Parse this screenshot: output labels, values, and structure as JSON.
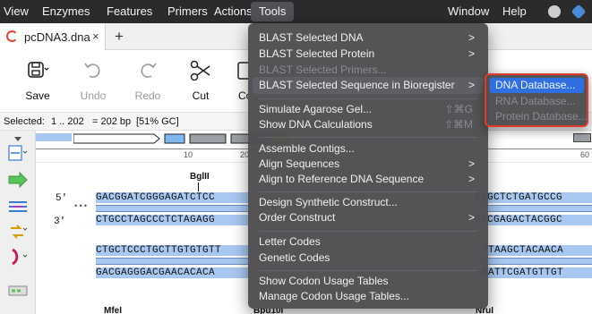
{
  "menubar": {
    "items": [
      "View",
      "Enzymes",
      "Features",
      "Primers",
      "Actions",
      "Tools"
    ],
    "right_items": [
      "Window",
      "Help"
    ]
  },
  "tabs": {
    "active_tab": "pcDNA3.dna",
    "close": "×",
    "new_tab": "+"
  },
  "toolbar": {
    "save": "Save",
    "undo": "Undo",
    "redo": "Redo",
    "cut": "Cut",
    "partial": "Co"
  },
  "status": {
    "selected": "Selected:",
    "range": "1 .. 202",
    "length": "=  202 bp",
    "gc": "[51% GC]"
  },
  "ruler": [
    "10",
    "20",
    "60"
  ],
  "sequence": {
    "enzyme_top": "BglII",
    "five_prime": "5'",
    "three_prime": "3'",
    "ellipsis": "•••",
    "row1_top_left": "GACGGATCGGGAGATCTCC",
    "row1_bottom_left": "CTGCCTAGCCCTCTAGAGG",
    "row1_top_right": "CTGCTCTGATGCCG",
    "row1_bottom_right": "GACGAGACTACGGC",
    "row2_top_left": "CTGCTCCCTGCTTGTGTGTT",
    "row2_bottom_left": "GACGAGGGACGAACACACA",
    "row2_top_right": "TTAAGCTACAACA",
    "row2_bottom_right": "AATTCGATGTTGT",
    "enzymes_bottom": [
      "MfeI",
      "Bpu10I",
      "NruI"
    ]
  },
  "tools_menu": [
    {
      "label": "BLAST Selected DNA",
      "arrow": ">",
      "disabled": false
    },
    {
      "label": "BLAST Selected Protein",
      "arrow": ">",
      "disabled": false
    },
    {
      "label": "BLAST Selected Primers...",
      "disabled": true
    },
    {
      "label": "BLAST Selected Sequence in Bioregister",
      "arrow": ">",
      "disabled": false,
      "highlighted": true
    },
    {
      "label": "Simulate Agarose Gel...",
      "shortcut": "⇧⌘G",
      "disabled": false
    },
    {
      "label": "Show DNA Calculations",
      "shortcut": "⇧⌘M",
      "disabled": false
    },
    {
      "label": "Assemble Contigs...",
      "disabled": false
    },
    {
      "label": "Align Sequences",
      "arrow": ">",
      "disabled": false
    },
    {
      "label": "Align to Reference DNA Sequence",
      "arrow": ">",
      "disabled": false
    },
    {
      "label": "Design Synthetic Construct...",
      "disabled": false
    },
    {
      "label": "Order Construct",
      "arrow": ">",
      "disabled": false
    },
    {
      "label": "Letter Codes",
      "disabled": false
    },
    {
      "label": "Genetic Codes",
      "disabled": false
    },
    {
      "label": "Show Codon Usage Tables",
      "disabled": false
    },
    {
      "label": "Manage Codon Usage Tables...",
      "disabled": false
    }
  ],
  "submenu": [
    {
      "label": "DNA Database...",
      "selected": true
    },
    {
      "label": "RNA Database...",
      "disabled": true
    },
    {
      "label": "Protein Database...",
      "disabled": true
    }
  ],
  "colors": {
    "menubar": "#2b2b2d",
    "menu_bg": "#4e4e52",
    "highlight_blue": "#2f6fe0",
    "submenu_border": "#e03a2e",
    "sequence_highlight": "#a9c8f1"
  }
}
